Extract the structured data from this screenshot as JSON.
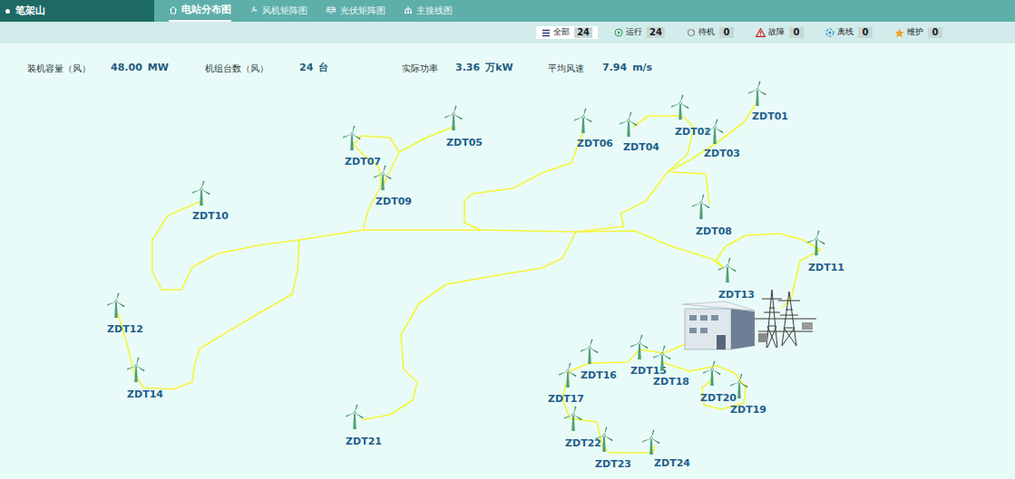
{
  "station": {
    "name": "笔架山"
  },
  "tabs": [
    {
      "label": "电站分布图",
      "selected": true
    },
    {
      "label": "风机矩阵图",
      "selected": false
    },
    {
      "label": "光伏矩阵图",
      "selected": false
    },
    {
      "label": "主接线图",
      "selected": false
    }
  ],
  "filters": [
    {
      "label": "全部",
      "count": "24",
      "selected": true
    },
    {
      "label": "运行",
      "count": "24",
      "selected": false
    },
    {
      "label": "待机",
      "count": "0",
      "selected": false
    },
    {
      "label": "故障",
      "count": "0",
      "selected": false
    },
    {
      "label": "离线",
      "count": "0",
      "selected": false
    },
    {
      "label": "维护",
      "count": "0",
      "selected": false
    }
  ],
  "stats": [
    {
      "label": "装机容量（风）",
      "value": "48.00",
      "unit": "MW"
    },
    {
      "label": "机组台数（风）",
      "value": "24",
      "unit": "台"
    },
    {
      "label": "实际功率",
      "value": "3.36",
      "unit": "万kW"
    },
    {
      "label": "平均风速",
      "value": "7.94",
      "unit": "m/s"
    }
  ],
  "turbines": [
    {
      "name": "ZDT01"
    },
    {
      "name": "ZDT02"
    },
    {
      "name": "ZDT03"
    },
    {
      "name": "ZDT04"
    },
    {
      "name": "ZDT05"
    },
    {
      "name": "ZDT06"
    },
    {
      "name": "ZDT07"
    },
    {
      "name": "ZDT08"
    },
    {
      "name": "ZDT09"
    },
    {
      "name": "ZDT10"
    },
    {
      "name": "ZDT11"
    },
    {
      "name": "ZDT12"
    },
    {
      "name": "ZDT13"
    },
    {
      "name": "ZDT14"
    },
    {
      "name": "ZDT15"
    },
    {
      "name": "ZDT16"
    },
    {
      "name": "ZDT17"
    },
    {
      "name": "ZDT18"
    },
    {
      "name": "ZDT19"
    },
    {
      "name": "ZDT20"
    },
    {
      "name": "ZDT21"
    },
    {
      "name": "ZDT22"
    },
    {
      "name": "ZDT23"
    },
    {
      "name": "ZDT24"
    }
  ]
}
